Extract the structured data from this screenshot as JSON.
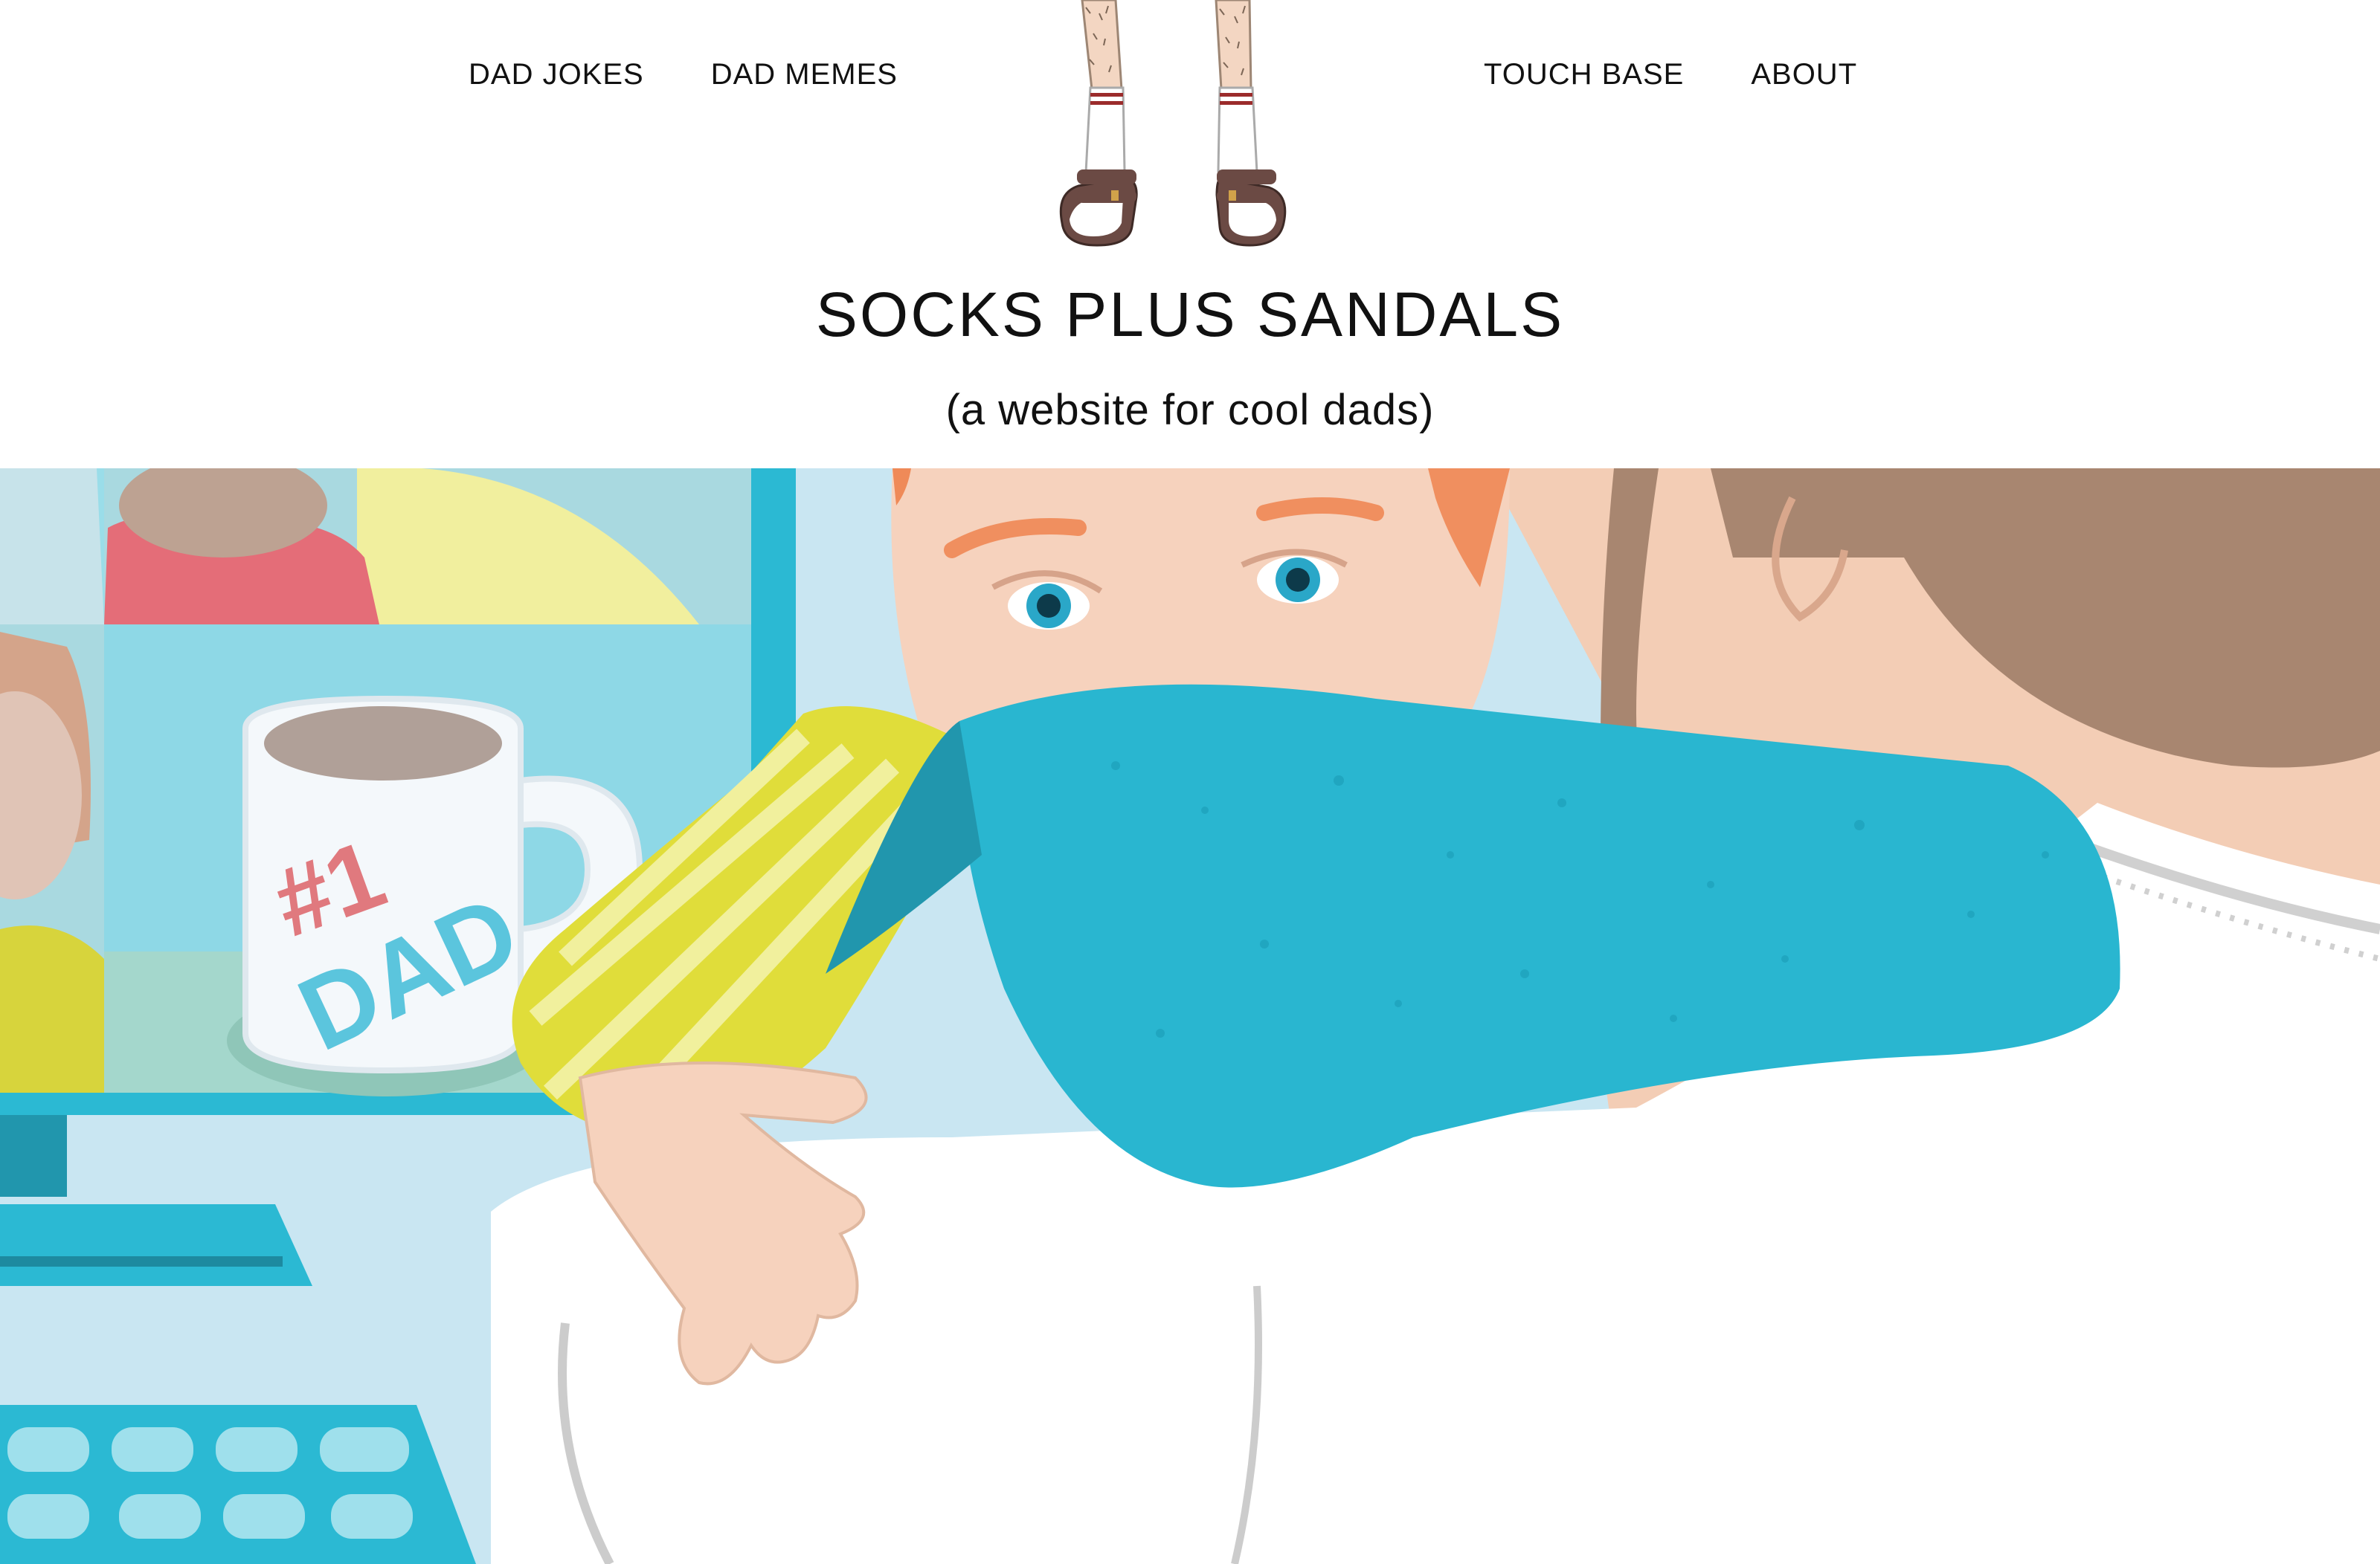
{
  "nav": {
    "left": [
      {
        "label": "DAD JOKES"
      },
      {
        "label": "DAD MEMES"
      }
    ],
    "right": [
      {
        "label": "TOUCH BASE"
      },
      {
        "label": "ABOUT"
      }
    ]
  },
  "site": {
    "title": "SOCKS PLUS SANDALS",
    "tagline": "(a website for cool dads)"
  },
  "hero": {
    "mug_text_1": "#1",
    "mug_text_2": "DAD"
  },
  "colors": {
    "accent_teal": "#29b6d0",
    "yellow": "#e0dd3a",
    "skin": "#f6d2bd",
    "hair_brown": "#a88670",
    "sock_stripe": "#9b2b2b",
    "sandal": "#6b4a44"
  },
  "icons": [
    "legs-socks-sandals-logo"
  ]
}
